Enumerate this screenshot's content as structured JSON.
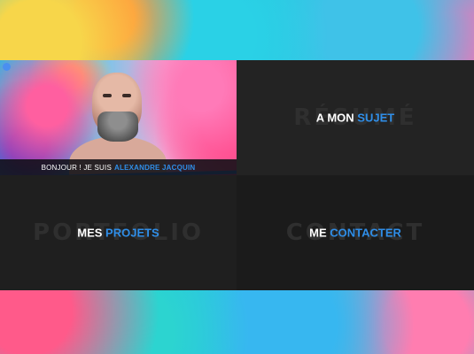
{
  "profile": {
    "greeting": "BONJOUR ! JE SUIS",
    "name": "ALEXANDRE JACQUIN",
    "icon": "lock-icon"
  },
  "tiles": {
    "resume": {
      "ghost": "RÉSUMÉ",
      "title_a": "A MON",
      "title_b": "SUJET"
    },
    "portfolio": {
      "ghost": "PORTFOLIO",
      "title_a": "MES",
      "title_b": "PROJETS"
    },
    "contact": {
      "ghost": "CONTACT",
      "title_a": "ME",
      "title_b": "CONTACTER"
    }
  },
  "colors": {
    "accent": "#2f8ee8",
    "tile_dark": "#232323",
    "tile_darker": "#1b1b1b"
  }
}
